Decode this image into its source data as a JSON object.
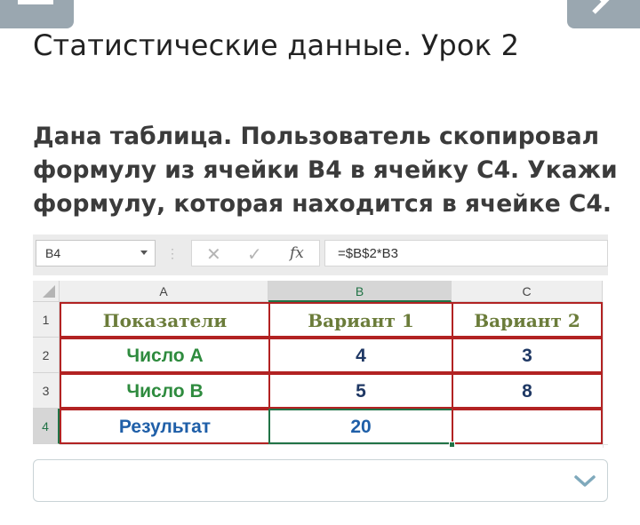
{
  "header": {
    "lesson_title": "Статистические данные. Урок 2"
  },
  "question": {
    "text": "Дана таблица. Пользователь скопировал формулу из ячейки B4 в ячейку C4. Укажи формулу, которая находится в ячейке C4."
  },
  "spreadsheet": {
    "name_box": "B4",
    "formula": "=$B$2*B3",
    "fx_label": "fx",
    "columns": [
      "A",
      "B",
      "C"
    ],
    "rows": [
      "1",
      "2",
      "3",
      "4"
    ],
    "cells": {
      "A1": "Показатели",
      "B1": "Вариант 1",
      "C1": "Вариант 2",
      "A2": "Число А",
      "B2": "4",
      "C2": "3",
      "A3": "Число В",
      "B3": "5",
      "C3": "8",
      "A4": "Результат",
      "B4": "20",
      "C4": ""
    },
    "colors": {
      "border": "#b22222",
      "active": "#217346",
      "header_text": "#6b7c3a",
      "green_text": "#2e8b3e",
      "blue_text": "#1f5fa8"
    }
  },
  "answer": {
    "value": "",
    "icons": [
      "chevron-down-icon"
    ]
  }
}
